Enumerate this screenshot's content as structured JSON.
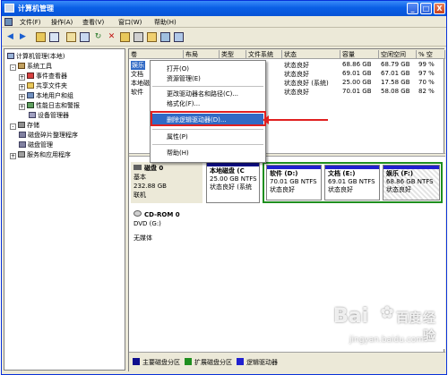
{
  "window": {
    "title": "计算机管理",
    "controls": {
      "minimize": "_",
      "maximize": "□",
      "close": "X"
    }
  },
  "menu": {
    "items": [
      "文件(F)",
      "操作(A)",
      "查看(V)",
      "窗口(W)",
      "帮助(H)"
    ]
  },
  "toolbar": {
    "icons": [
      "back-icon",
      "forward-icon",
      "up-folder-icon",
      "show-tree-icon",
      "properties-icon",
      "help-icon",
      "refresh-icon",
      "delete-icon",
      "new-icon",
      "open-icon",
      "format-icon",
      "settings-icon",
      "help-book-icon"
    ]
  },
  "tree": {
    "root": "计算机管理(本地)",
    "system_tools": "系统工具",
    "event_viewer": "事件查看器",
    "shared_folders": "共享文件夹",
    "local_users": "本地用户和组",
    "perf_logs": "性能日志和警报",
    "device_manager": "设备管理器",
    "storage": "存储",
    "defrag": "磁盘碎片整理程序",
    "disk_management": "磁盘管理",
    "services": "服务和应用程序"
  },
  "volume_list": {
    "headers": [
      "卷",
      "布局",
      "类型",
      "文件系统",
      "状态",
      "容量",
      "空闲空间",
      "% 空"
    ],
    "rows": [
      {
        "name": "娱乐",
        "status": "状态良好",
        "capacity": "68.86 GB",
        "free": "68.79 GB",
        "pct": "99 %"
      },
      {
        "name": "文档",
        "status": "状态良好",
        "capacity": "69.01 GB",
        "free": "67.01 GB",
        "pct": "97 %"
      },
      {
        "name": "本地磁",
        "status": "状态良好 (系统)",
        "capacity": "25.00 GB",
        "free": "17.58 GB",
        "pct": "70 %"
      },
      {
        "name": "软件",
        "status": "状态良好",
        "capacity": "70.01 GB",
        "free": "58.08 GB",
        "pct": "82 %"
      }
    ]
  },
  "context_menu": {
    "open": "打开(O)",
    "explore": "资源管理(E)",
    "change_letter": "更改驱动器名和路径(C)...",
    "format": "格式化(F)...",
    "delete": "删除逻辑驱动器(D)...",
    "properties": "属性(P)",
    "help": "帮助(H)"
  },
  "disk0": {
    "name": "磁盘 0",
    "type": "基本",
    "size": "232.88 GB",
    "state": "联机",
    "partitions": [
      {
        "name": "本地磁盘  (C",
        "size": "25.00 GB NTFS",
        "status": "状态良好 (系统"
      },
      {
        "name": "软件  (D:)",
        "size": "70.01 GB NTFS",
        "status": "状态良好"
      },
      {
        "name": "文档  (E:)",
        "size": "69.01 GB NTFS",
        "status": "状态良好"
      },
      {
        "name": "娱乐  (F:)",
        "size": "68.86 GB NTFS",
        "status": "状态良好"
      }
    ]
  },
  "cdrom0": {
    "name": "CD-ROM 0",
    "type": "DVD (G:)",
    "state": "无媒体"
  },
  "legend": {
    "primary": "主要磁盘分区",
    "extended": "扩展磁盘分区",
    "logical": "逻辑驱动器",
    "primary_color": "#0e0e8e",
    "extended_color": "#1f8f1f",
    "logical_color": "#2020d0"
  },
  "watermark": {
    "brand": "Bai",
    "brand_cn": "百度",
    "sub": "经验",
    "url": "jingyan.baidu.com"
  }
}
